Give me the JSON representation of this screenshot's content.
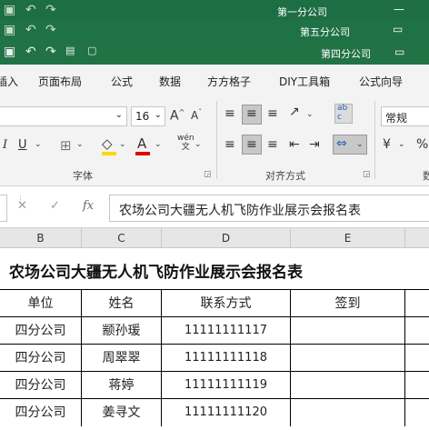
{
  "titlebars": [
    {
      "title": "第一分公司"
    },
    {
      "title": "第五分公司"
    },
    {
      "title": "第四分公司"
    }
  ],
  "ribbon_tabs": [
    "插入",
    "页面布局",
    "公式",
    "数据",
    "方方格子",
    "DIY工具箱",
    "公式向导"
  ],
  "ribbon": {
    "font_size": "16",
    "number_format": "常规",
    "group_font": "字体",
    "group_align": "对齐方式",
    "group_number": "数",
    "wen_label": "wén\n文",
    "ab_label": "ab\nc"
  },
  "formula_bar": {
    "value": "农场公司大疆无人机飞防作业展示会报名表"
  },
  "columns": [
    "B",
    "C",
    "D",
    "E"
  ],
  "sheet": {
    "title": "农场公司大疆无人机飞防作业展示会报名表",
    "headers": [
      "单位",
      "姓名",
      "联系方式",
      "签到"
    ],
    "rows": [
      {
        "unit": "四分公司",
        "name": "颛孙瑗",
        "phone": "11111111117",
        "sign": ""
      },
      {
        "unit": "四分公司",
        "name": "周翠翠",
        "phone": "11111111118",
        "sign": ""
      },
      {
        "unit": "四分公司",
        "name": "蒋婷",
        "phone": "11111111119",
        "sign": ""
      },
      {
        "unit": "四分公司",
        "name": "姜寻文",
        "phone": "11111111120",
        "sign": ""
      }
    ]
  },
  "colors": {
    "excel_green": "#217346",
    "ribbon_bg": "#f3f3f3",
    "font_red": "#e00000",
    "highlight_yellow": "#ffd800"
  }
}
